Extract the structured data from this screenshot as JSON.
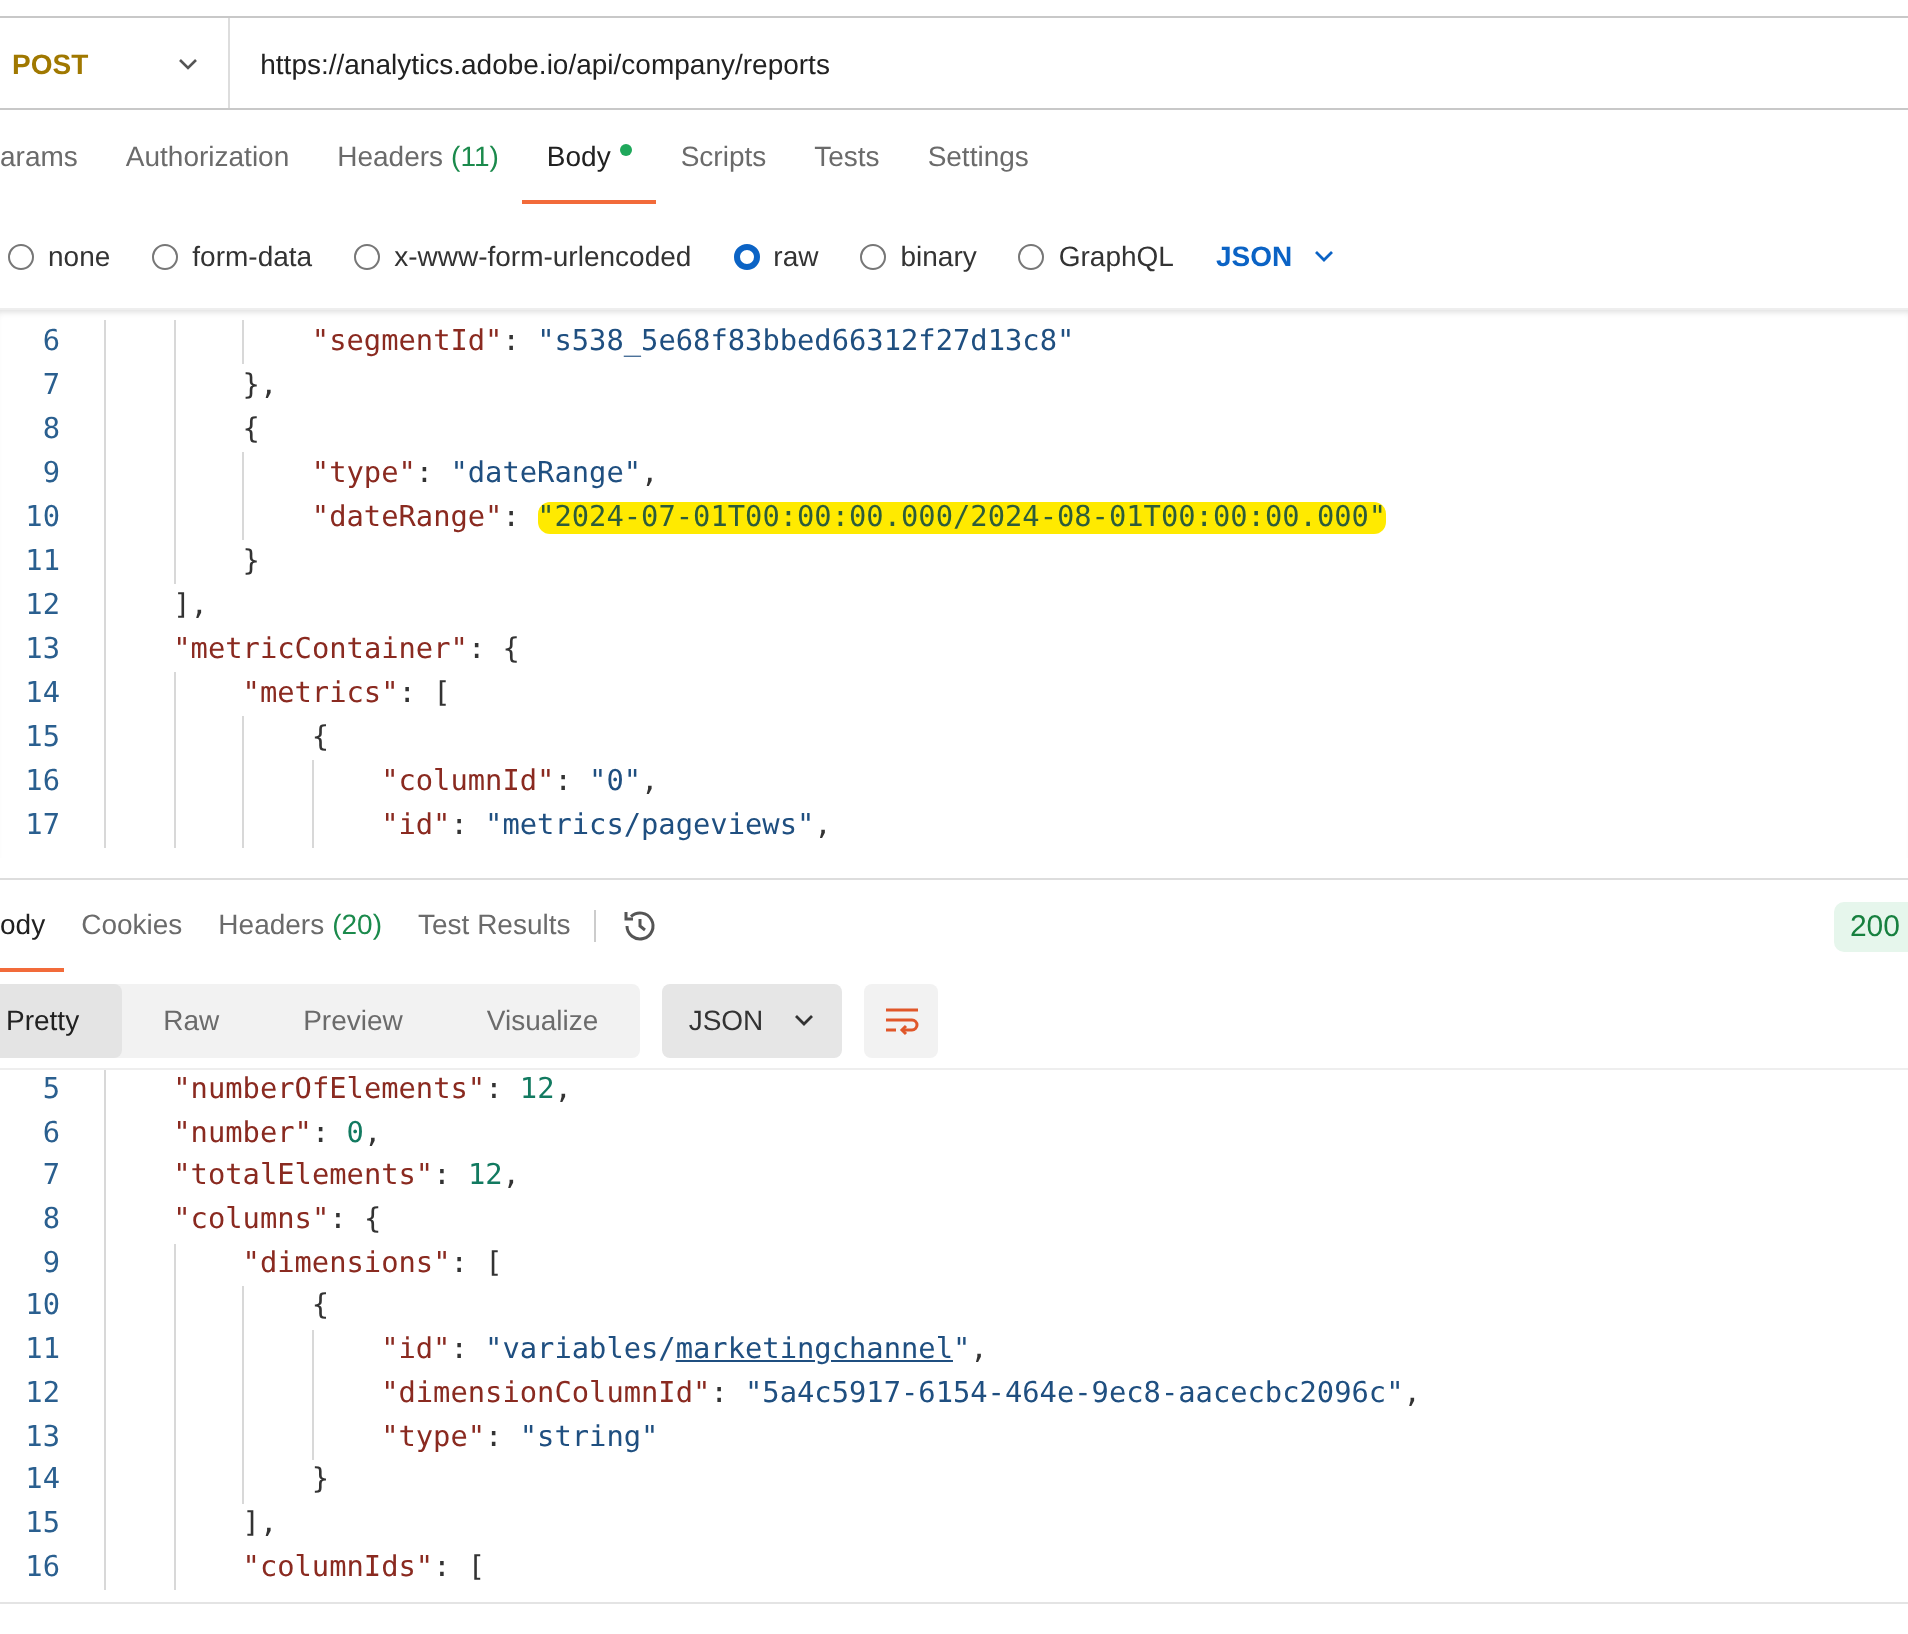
{
  "request": {
    "method": "POST",
    "url": "https://analytics.adobe.io/api/company/reports",
    "tabs": [
      {
        "label": "arams",
        "dot": false,
        "selected": false
      },
      {
        "label": "Authorization",
        "dot": false,
        "selected": false
      },
      {
        "label": "Headers",
        "count": "(11)",
        "dot": false,
        "selected": false
      },
      {
        "label": "Body",
        "dot": true,
        "selected": true
      },
      {
        "label": "Scripts",
        "dot": false,
        "selected": false
      },
      {
        "label": "Tests",
        "dot": false,
        "selected": false
      },
      {
        "label": "Settings",
        "dot": false,
        "selected": false
      }
    ],
    "body_types": [
      {
        "label": "none",
        "selected": false
      },
      {
        "label": "form-data",
        "selected": false
      },
      {
        "label": "x-www-form-urlencoded",
        "selected": false
      },
      {
        "label": "raw",
        "selected": true
      },
      {
        "label": "binary",
        "selected": false
      },
      {
        "label": "GraphQL",
        "selected": false
      }
    ],
    "language": "JSON",
    "body_lines": [
      {
        "children": [
          {
            "children": [
              {
                "number": "6",
                "tokens": [
                  {
                    "kind": "key",
                    "text": "\"segmentId\""
                  },
                  {
                    "kind": "punct",
                    "text": ": "
                  },
                  {
                    "kind": "str",
                    "text": "\"s538_5e68f83bbed66312f27d13c8\""
                  }
                ]
              }
            ]
          },
          {
            "number": "7",
            "tokens": [
              {
                "kind": "punct",
                "text": "},"
              }
            ]
          },
          {
            "number": "8",
            "tokens": [
              {
                "kind": "punct",
                "text": "{"
              }
            ],
            "children": [
              {
                "number": "9",
                "tokens": [
                  {
                    "kind": "key",
                    "text": "\"type\""
                  },
                  {
                    "kind": "punct",
                    "text": ": "
                  },
                  {
                    "kind": "str",
                    "text": "\"dateRange\""
                  },
                  {
                    "kind": "punct",
                    "text": ","
                  }
                ]
              },
              {
                "number": "10",
                "tokens": [
                  {
                    "kind": "key",
                    "text": "\"dateRange\""
                  },
                  {
                    "kind": "punct",
                    "text": ": "
                  },
                  {
                    "kind": "highlight",
                    "text": "\"2024-07-01T00:00:00.000/2024-08-01T00:00:00.000\""
                  }
                ]
              }
            ]
          },
          {
            "number": "11",
            "tokens": [
              {
                "kind": "punct",
                "text": "}"
              }
            ]
          }
        ]
      },
      {
        "number": "12",
        "tokens": [
          {
            "kind": "punct",
            "text": "],"
          }
        ]
      },
      {
        "number": "13",
        "tokens": [
          {
            "kind": "key",
            "text": "\"metricContainer\""
          },
          {
            "kind": "punct",
            "text": ": {"
          }
        ],
        "children": [
          {
            "number": "14",
            "tokens": [
              {
                "kind": "key",
                "text": "\"metrics\""
              },
              {
                "kind": "punct",
                "text": ": ["
              }
            ],
            "children": [
              {
                "number": "15",
                "tokens": [
                  {
                    "kind": "punct",
                    "text": "{"
                  }
                ],
                "children": [
                  {
                    "number": "16",
                    "tokens": [
                      {
                        "kind": "key",
                        "text": "\"columnId\""
                      },
                      {
                        "kind": "punct",
                        "text": ": "
                      },
                      {
                        "kind": "str",
                        "text": "\"0\""
                      },
                      {
                        "kind": "punct",
                        "text": ","
                      }
                    ]
                  },
                  {
                    "number": "17",
                    "tokens": [
                      {
                        "kind": "key",
                        "text": "\"id\""
                      },
                      {
                        "kind": "punct",
                        "text": ": "
                      },
                      {
                        "kind": "str",
                        "text": "\"metrics/pageviews\""
                      },
                      {
                        "kind": "punct",
                        "text": ","
                      }
                    ]
                  }
                ]
              }
            ]
          }
        ]
      }
    ]
  },
  "response": {
    "tabs": [
      {
        "label": "ody",
        "selected": true
      },
      {
        "label": "Cookies",
        "selected": false
      },
      {
        "label": "Headers",
        "count": "(20)",
        "selected": false
      },
      {
        "label": "Test Results",
        "selected": false
      }
    ],
    "status": "200",
    "views": [
      {
        "label": "Pretty",
        "selected": true
      },
      {
        "label": "Raw",
        "selected": false
      },
      {
        "label": "Preview",
        "selected": false
      },
      {
        "label": "Visualize",
        "selected": false
      }
    ],
    "format": "JSON",
    "body_lines": [
      {
        "number": "5",
        "tokens": [
          {
            "kind": "key",
            "text": "\"numberOfElements\""
          },
          {
            "kind": "punct",
            "text": ": "
          },
          {
            "kind": "num",
            "text": "12"
          },
          {
            "kind": "punct",
            "text": ","
          }
        ]
      },
      {
        "number": "6",
        "tokens": [
          {
            "kind": "key",
            "text": "\"number\""
          },
          {
            "kind": "punct",
            "text": ": "
          },
          {
            "kind": "num",
            "text": "0"
          },
          {
            "kind": "punct",
            "text": ","
          }
        ]
      },
      {
        "number": "7",
        "tokens": [
          {
            "kind": "key",
            "text": "\"totalElements\""
          },
          {
            "kind": "punct",
            "text": ": "
          },
          {
            "kind": "num",
            "text": "12"
          },
          {
            "kind": "punct",
            "text": ","
          }
        ]
      },
      {
        "number": "8",
        "tokens": [
          {
            "kind": "key",
            "text": "\"columns\""
          },
          {
            "kind": "punct",
            "text": ": {"
          }
        ],
        "children": [
          {
            "number": "9",
            "tokens": [
              {
                "kind": "key",
                "text": "\"dimensions\""
              },
              {
                "kind": "punct",
                "text": ": ["
              }
            ],
            "children": [
              {
                "number": "10",
                "tokens": [
                  {
                    "kind": "punct",
                    "text": "{"
                  }
                ],
                "children": [
                  {
                    "number": "11",
                    "tokens": [
                      {
                        "kind": "key",
                        "text": "\"id\""
                      },
                      {
                        "kind": "punct",
                        "text": ": "
                      },
                      {
                        "kind": "str",
                        "text": "\"variables/"
                      },
                      {
                        "kind": "link",
                        "text": "marketingchannel"
                      },
                      {
                        "kind": "str",
                        "text": "\""
                      },
                      {
                        "kind": "punct",
                        "text": ","
                      }
                    ]
                  },
                  {
                    "number": "12",
                    "tokens": [
                      {
                        "kind": "key",
                        "text": "\"dimensionColumnId\""
                      },
                      {
                        "kind": "punct",
                        "text": ": "
                      },
                      {
                        "kind": "str",
                        "text": "\"5a4c5917-6154-464e-9ec8-aacecbc2096c\""
                      },
                      {
                        "kind": "punct",
                        "text": ","
                      }
                    ]
                  },
                  {
                    "number": "13",
                    "tokens": [
                      {
                        "kind": "key",
                        "text": "\"type\""
                      },
                      {
                        "kind": "punct",
                        "text": ": "
                      },
                      {
                        "kind": "str",
                        "text": "\"string\""
                      }
                    ]
                  }
                ]
              },
              {
                "number": "14",
                "tokens": [
                  {
                    "kind": "punct",
                    "text": "}"
                  }
                ]
              }
            ]
          },
          {
            "number": "15",
            "tokens": [
              {
                "kind": "punct",
                "text": "],"
              }
            ]
          },
          {
            "number": "16",
            "tokens": [
              {
                "kind": "key",
                "text": "\"columnIds\""
              },
              {
                "kind": "punct",
                "text": ": ["
              }
            ]
          }
        ]
      }
    ]
  }
}
